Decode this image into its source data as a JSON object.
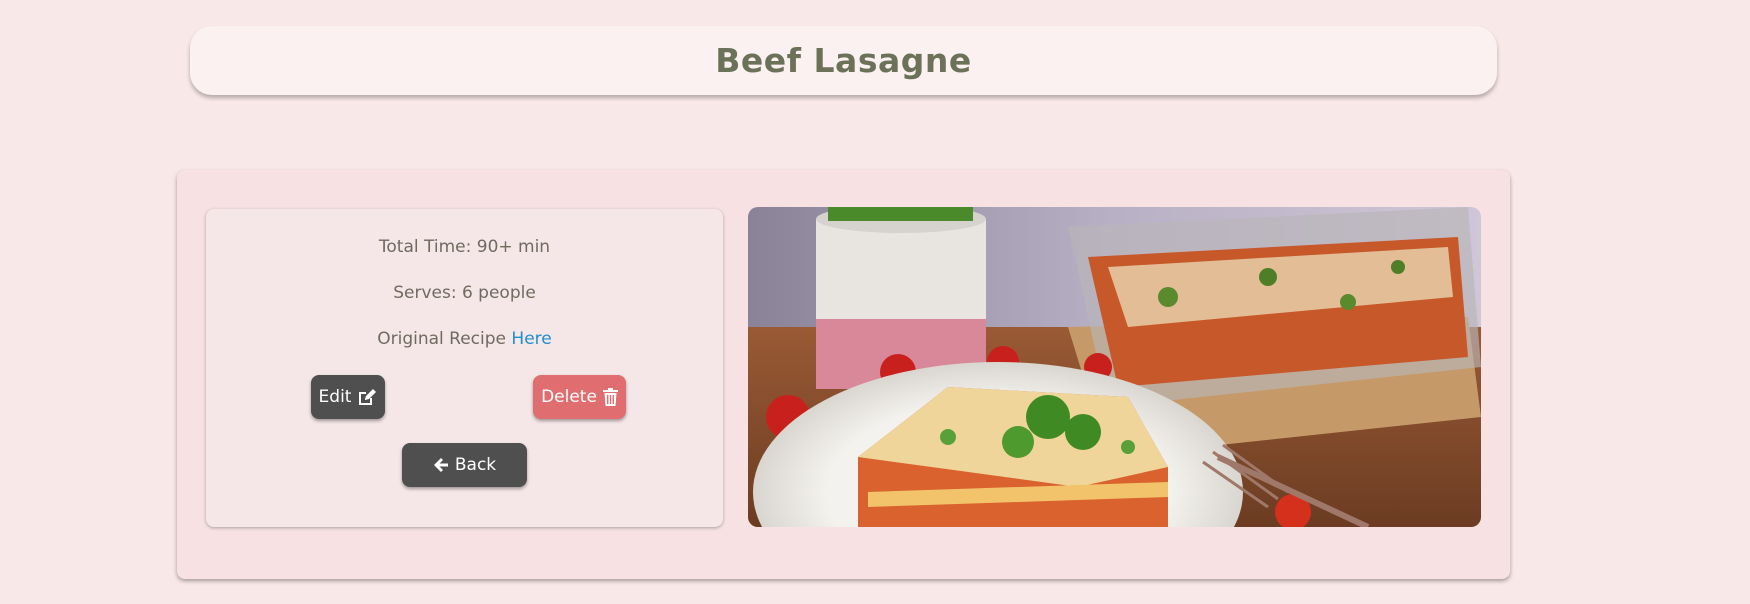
{
  "header": {
    "title": "Beef Lasagne"
  },
  "recipe": {
    "total_time": "Total Time: 90+ min",
    "serves": "Serves: 6 people",
    "original_recipe_label": "Original Recipe ",
    "original_recipe_link": "Here"
  },
  "actions": {
    "edit_label": "Edit",
    "delete_label": "Delete",
    "back_label": "Back"
  },
  "icons": {
    "edit": "edit-icon",
    "delete": "trash-icon",
    "back": "arrow-left-icon"
  },
  "colors": {
    "background": "#f9e8e8",
    "title": "#6b7258",
    "link": "#1e90d0",
    "dark_button": "#4f4f4f",
    "delete_button": "#e06d70"
  }
}
